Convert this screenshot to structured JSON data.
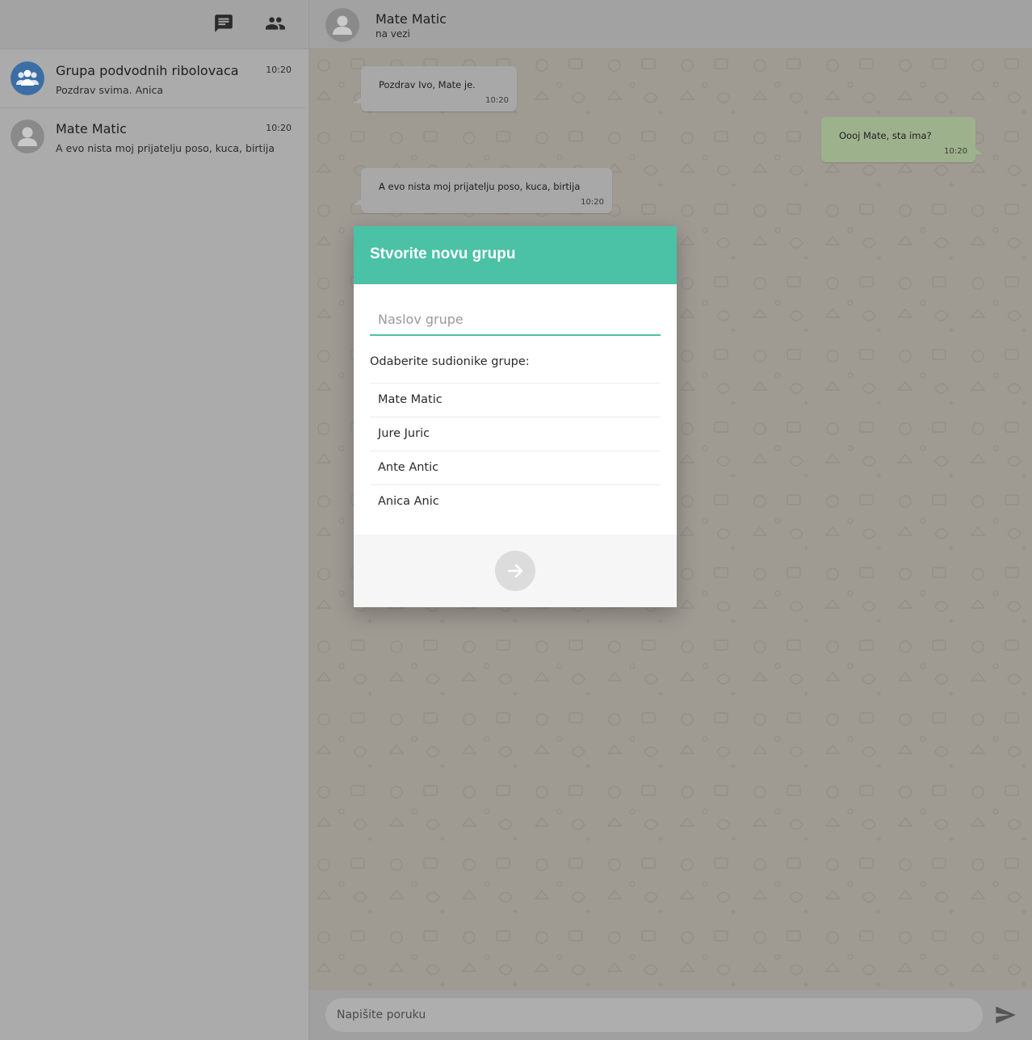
{
  "sidebar": {
    "header_icons": [
      "chat-icon",
      "group-icon"
    ],
    "chats": [
      {
        "name": "Grupa podvodnih ribolovaca",
        "time": "10:20",
        "preview": "Pozdrav svima. Anica",
        "avatar": "group-avatar-icon"
      },
      {
        "name": "Mate Matic",
        "time": "10:20",
        "preview": "A evo nista moj prijatelju poso, kuca, birtija",
        "avatar": "person-avatar-icon"
      }
    ]
  },
  "conversation": {
    "contact_name": "Mate Matic",
    "status": "na vezi",
    "messages": [
      {
        "direction": "in",
        "text": "Pozdrav Ivo, Mate je.",
        "time": "10:20"
      },
      {
        "direction": "out",
        "text": "Oooj Mate, sta ima?",
        "time": "10:20"
      },
      {
        "direction": "in",
        "text": "A evo nista moj prijatelju poso, kuca, birtija",
        "time": "10:20"
      }
    ],
    "composer_placeholder": "Napišite poruku"
  },
  "modal": {
    "title": "Stvorite novu grupu",
    "group_title_placeholder": "Naslov grupe",
    "select_label": "Odaberite sudionike grupe:",
    "participants": [
      "Mate Matic",
      "Jure Juric",
      "Ante Antic",
      "Anica Anic"
    ]
  },
  "colors": {
    "accent": "#4bc1a6",
    "incoming_bubble": "#a8a8a8",
    "outgoing_bubble": "#9eb18d",
    "avatar_group": "#3b6ea5",
    "avatar_person": "#8a8a8a"
  }
}
